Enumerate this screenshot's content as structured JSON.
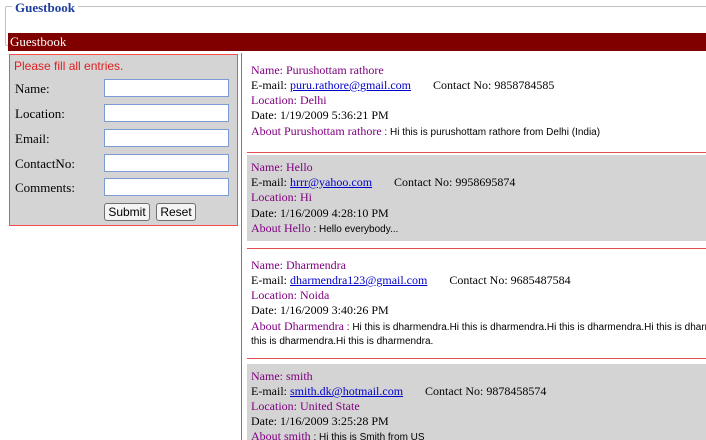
{
  "header": {
    "legend": "Guestbook",
    "bar_title": "Guestbook"
  },
  "form": {
    "message": "Please fill all entries.",
    "fields": [
      {
        "label": "Name:",
        "value": ""
      },
      {
        "label": "Location:",
        "value": ""
      },
      {
        "label": "Email:",
        "value": ""
      },
      {
        "label": "ContactNo:",
        "value": ""
      },
      {
        "label": "Comments:",
        "value": ""
      }
    ],
    "submit_label": "Submit",
    "reset_label": "Reset"
  },
  "labels": {
    "name": "Name: ",
    "email": "E-mail: ",
    "contact": "Contact No: ",
    "location": "Location: ",
    "date": "Date: "
  },
  "entries": [
    {
      "name": "Purushottam rathore",
      "email": "puru.rathore@gmail.com",
      "contact": "9858784585",
      "location": "Delhi",
      "date": "1/19/2009 5:36:21 PM",
      "about_label": "About Purushottam rathore",
      "about_text": " : Hi this is purushottam rathore from Delhi (India)",
      "about_text2": ""
    },
    {
      "name": "Hello",
      "email": "hrrr@yahoo.com",
      "contact": "9958695874",
      "location": "Hi",
      "date": "1/16/2009 4:28:10 PM",
      "about_label": "About Hello",
      "about_text": " : Hello everybody...",
      "about_text2": ""
    },
    {
      "name": "Dharmendra",
      "email": "dharmendra123@gmail.com",
      "contact": "9685487584",
      "location": "Noida",
      "date": "1/16/2009 3:40:26 PM",
      "about_label": "About Dharmendra",
      "about_text": " : Hi this is dharmendra.Hi this is dharmendra.Hi this is dharmendra.Hi this is dharmendra.",
      "about_text2": "this is dharmendra.Hi this is dharmendra."
    },
    {
      "name": "smith",
      "email": "smith.dk@hotmail.com",
      "contact": "9878458574",
      "location": "United State",
      "date": "1/16/2009 3:25:28 PM",
      "about_label": "About smith",
      "about_text": " : Hi this is Smith from US",
      "about_text2": ""
    }
  ]
}
